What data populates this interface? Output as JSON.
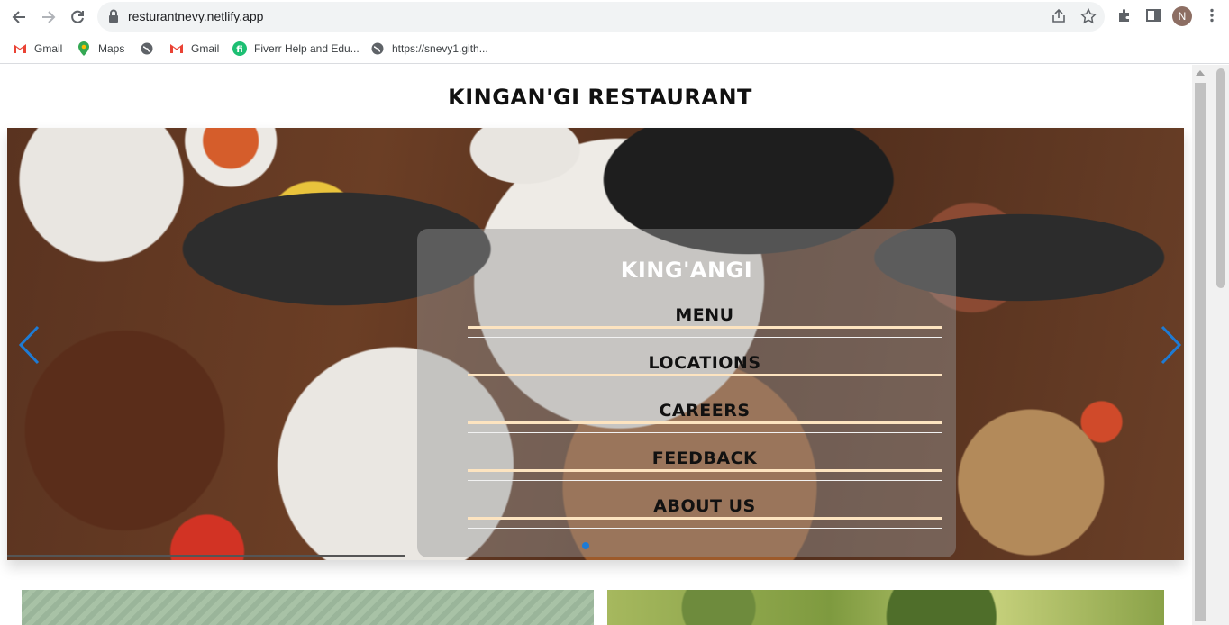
{
  "browser": {
    "url": "resturantnevy.netlify.app",
    "avatar_initial": "N",
    "bookmarks": [
      {
        "label": "Gmail",
        "icon": "gmail-icon"
      },
      {
        "label": "Maps",
        "icon": "maps-icon"
      },
      {
        "label": "",
        "icon": "globe-icon"
      },
      {
        "label": "Gmail",
        "icon": "gmail-icon"
      },
      {
        "label": "Fiverr Help and Edu...",
        "icon": "fiverr-icon"
      },
      {
        "label": "https://snevy1.gith...",
        "icon": "globe-icon"
      }
    ]
  },
  "page": {
    "title": "KINGAN'GI RESTAURANT",
    "hero": {
      "brand": "KING'ANGI",
      "menu": [
        "MENU",
        "LOCATIONS",
        "CAREERS",
        "FEEDBACK",
        "ABOUT US"
      ],
      "accent": "#1e7bd4",
      "line_color": "#fde4c0"
    }
  }
}
